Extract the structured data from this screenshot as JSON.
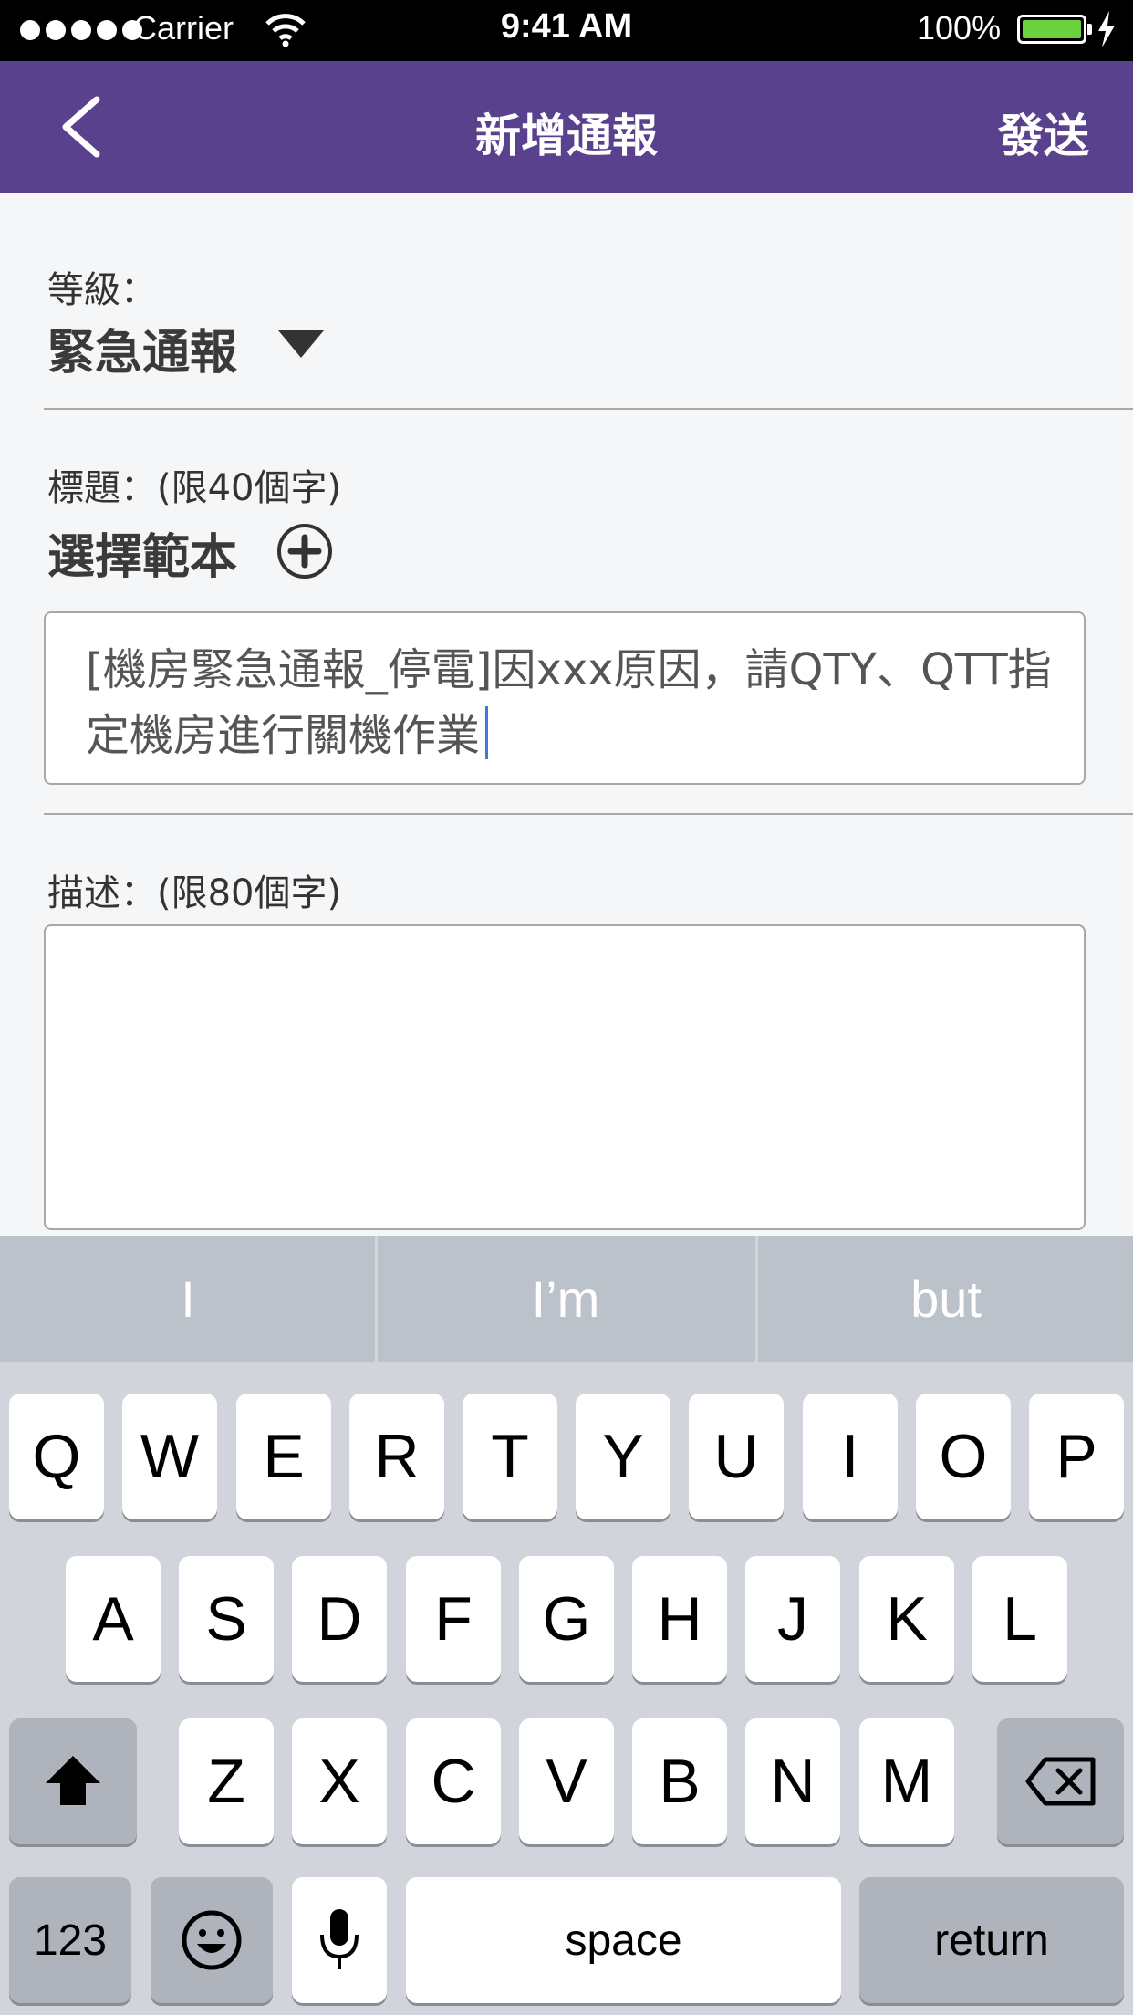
{
  "status_bar": {
    "carrier": "Carrier",
    "time": "9:41 AM",
    "battery_percent": "100%",
    "battery_level": 1.0,
    "battery_color": "#6bd13c"
  },
  "nav": {
    "title": "新增通報",
    "send_label": "發送",
    "background": "#5a418e"
  },
  "form": {
    "level_label": "等級：",
    "level_value": "緊急通報",
    "title_label": "標題：(限40個字)",
    "template_label": "選擇範本",
    "title_text": "[機房緊急通報_停電]因xxx原因，請QTY、QTT指定機房進行關機作業",
    "description_label": "描述：(限80個字)",
    "description_text": ""
  },
  "keyboard": {
    "suggestions": [
      "I",
      "I’m",
      "but"
    ],
    "row1": [
      "Q",
      "W",
      "E",
      "R",
      "T",
      "Y",
      "U",
      "I",
      "O",
      "P"
    ],
    "row2": [
      "A",
      "S",
      "D",
      "F",
      "G",
      "H",
      "J",
      "K",
      "L"
    ],
    "row3": [
      "Z",
      "X",
      "C",
      "V",
      "B",
      "N",
      "M"
    ],
    "numbers_label": "123",
    "space_label": "space",
    "return_label": "return"
  }
}
